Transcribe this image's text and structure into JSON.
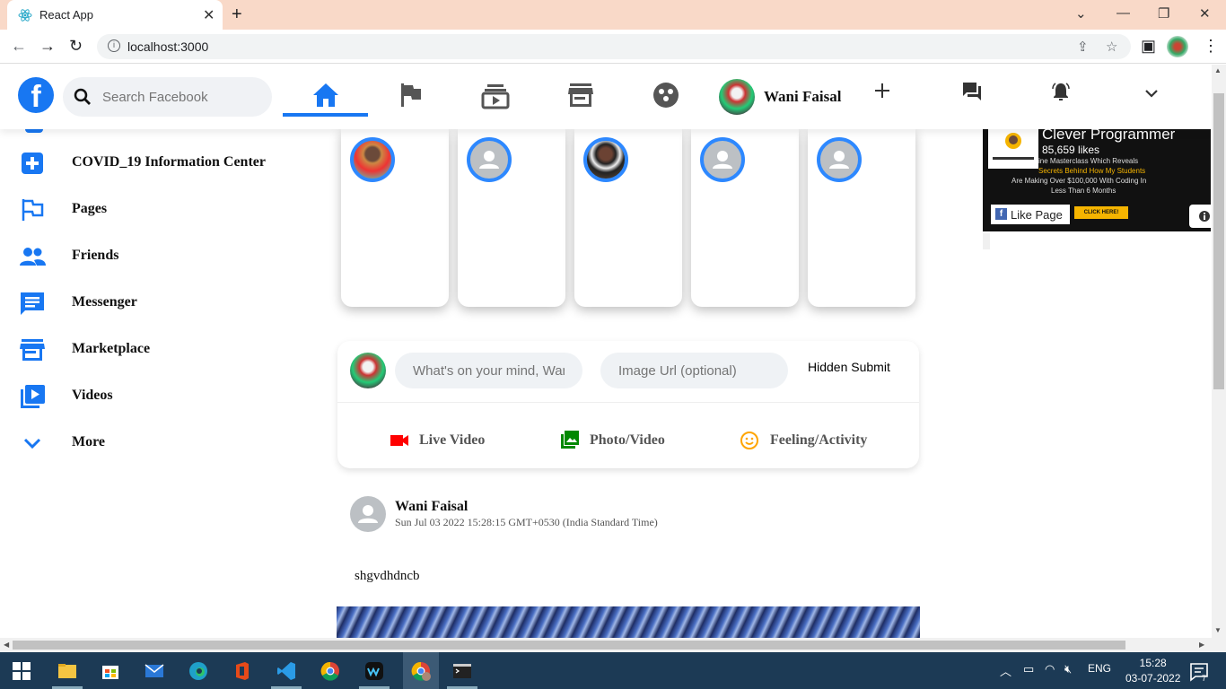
{
  "browser": {
    "tab_title": "React App",
    "url": "localhost:3000"
  },
  "header": {
    "search_placeholder": "Search Facebook",
    "user_name": "Wani Faisal"
  },
  "sidebar": {
    "items": [
      {
        "label": "COVID_19 Information Center",
        "icon": "plus-box-icon"
      },
      {
        "label": "Pages",
        "icon": "flag-icon"
      },
      {
        "label": "Friends",
        "icon": "people-icon"
      },
      {
        "label": "Messenger",
        "icon": "chat-icon"
      },
      {
        "label": "Marketplace",
        "icon": "store-icon"
      },
      {
        "label": "Videos",
        "icon": "video-library-icon"
      },
      {
        "label": "More",
        "icon": "chevron-down-icon"
      }
    ]
  },
  "composer": {
    "message_placeholder": "What's on your mind, Wani F",
    "image_placeholder": "Image Url (optional)",
    "submit_label": "Hidden Submit",
    "options": [
      {
        "label": "Live Video",
        "icon": "videocam-icon",
        "color": "#ff0000"
      },
      {
        "label": "Photo/Video",
        "icon": "photo-library-icon",
        "color": "#008000"
      },
      {
        "label": "Feeling/Activity",
        "icon": "emoji-icon",
        "color": "#ffa500"
      }
    ]
  },
  "post": {
    "username": "Wani Faisal",
    "timestamp": "Sun Jul 03 2022 15:28:15 GMT+0530 (India Standard Time)",
    "message": "shgvdhdncb"
  },
  "ad": {
    "title": "Clever Programmer",
    "likes": "85,659 likes",
    "line1": "ine Masterclass Which Reveals",
    "line2": "Secrets Behind How My Students",
    "line3": "Are Making Over $100,000 With Coding In",
    "line4": "Less Than 6 Months",
    "like_button": "Like Page",
    "cta": "CLICK HERE!",
    "logo_text": "cleverprogrammer"
  },
  "taskbar": {
    "lang": "ENG",
    "time": "15:28",
    "date": "03-07-2022",
    "notif_count": "7"
  },
  "colors": {
    "brand": "#1877f2",
    "story_ring": "#2d88ff"
  }
}
